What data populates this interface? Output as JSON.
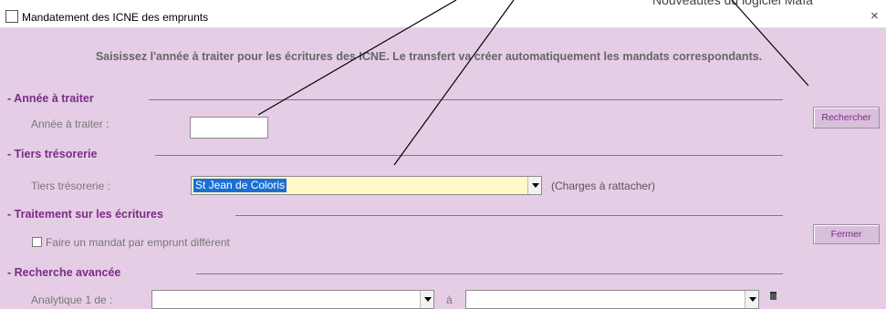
{
  "background_app_title_fragment": "Nouveautés du logiciel Maïa",
  "window": {
    "title": "Mandatement des ICNE des emprunts",
    "close_glyph": "×"
  },
  "instruction": "Saisissez l'année à traiter pour les écritures des ICNE. Le transfert va créer automatiquement les mandats correspondants.",
  "sections": {
    "annee": {
      "title": "- Année à traiter",
      "field_label": "Année à traiter :",
      "value": ""
    },
    "tiers": {
      "title": "- Tiers trésorerie",
      "field_label": "Tiers trésorerie :",
      "selected": "St Jean de Coloris",
      "note": "(Charges à rattacher)"
    },
    "traitement": {
      "title": "- Traitement sur les écritures",
      "checkbox_label": "Faire un mandat par emprunt différent",
      "checked": false
    },
    "recherche": {
      "title": "- Recherche avancée",
      "field_label": "Analytique 1 de :",
      "to_label": "à",
      "from_value": "",
      "to_value": ""
    }
  },
  "buttons": {
    "rechercher": "Rechercher",
    "fermer": "Fermer"
  },
  "colors": {
    "background": "#e5cde6",
    "section_title": "#7b2c84",
    "combo_highlight": "#fff8c9",
    "selection": "#1a6fd6"
  }
}
